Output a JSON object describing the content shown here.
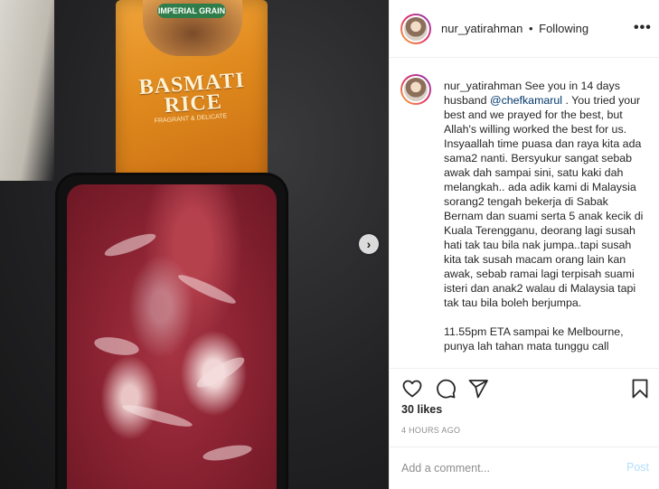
{
  "post": {
    "username": "nur_yatirahman",
    "separator": "•",
    "follow_status": "Following",
    "more_icon": "more-horizontal-icon",
    "more_label": "•••"
  },
  "photo": {
    "bag_brand": "IMPERIAL GRAIN",
    "bag_title": "BASMATI RICE",
    "bag_subtitle": "FRAGRANT & DELICATE",
    "next_icon": "chevron-right-icon",
    "next_label": "›"
  },
  "caption": {
    "username": "nur_yatirahman",
    "text_before_mention": " See you in 14 days husband ",
    "mention": "@chefkamarul",
    "text_after_mention": " . You tried your best and we prayed for the best, but Allah's willing worked the best for us. Insyaallah time puasa dan raya kita ada sama2 nanti. Bersyukur sangat sebab awak dah sampai sini, satu kaki dah melangkah.. ada adik kami di Malaysia sorang2 tengah bekerja di Sabak Bernam dan suami serta 5 anak kecik di Kuala Terengganu, deorang lagi susah hati tak tau bila nak jumpa..tapi susah kita tak susah macam orang lain kan awak, sebab ramai lagi terpisah suami isteri dan anak2 walau di Malaysia tapi tak tau bila boleh berjumpa.\n\n11.55pm ETA sampai ke Melbourne, punya lah tahan mata tunggu call"
  },
  "actions": {
    "like_icon": "heart-icon",
    "comment_icon": "comment-icon",
    "share_icon": "share-icon",
    "save_icon": "bookmark-icon"
  },
  "likes": "30 likes",
  "timestamp": "4 HOURS AGO",
  "comment": {
    "placeholder": "Add a comment...",
    "post_label": "Post"
  },
  "colors": {
    "mention": "#00376b",
    "post_disabled": "#b2dffc",
    "muted": "#8e8e8e",
    "text": "#262626"
  }
}
